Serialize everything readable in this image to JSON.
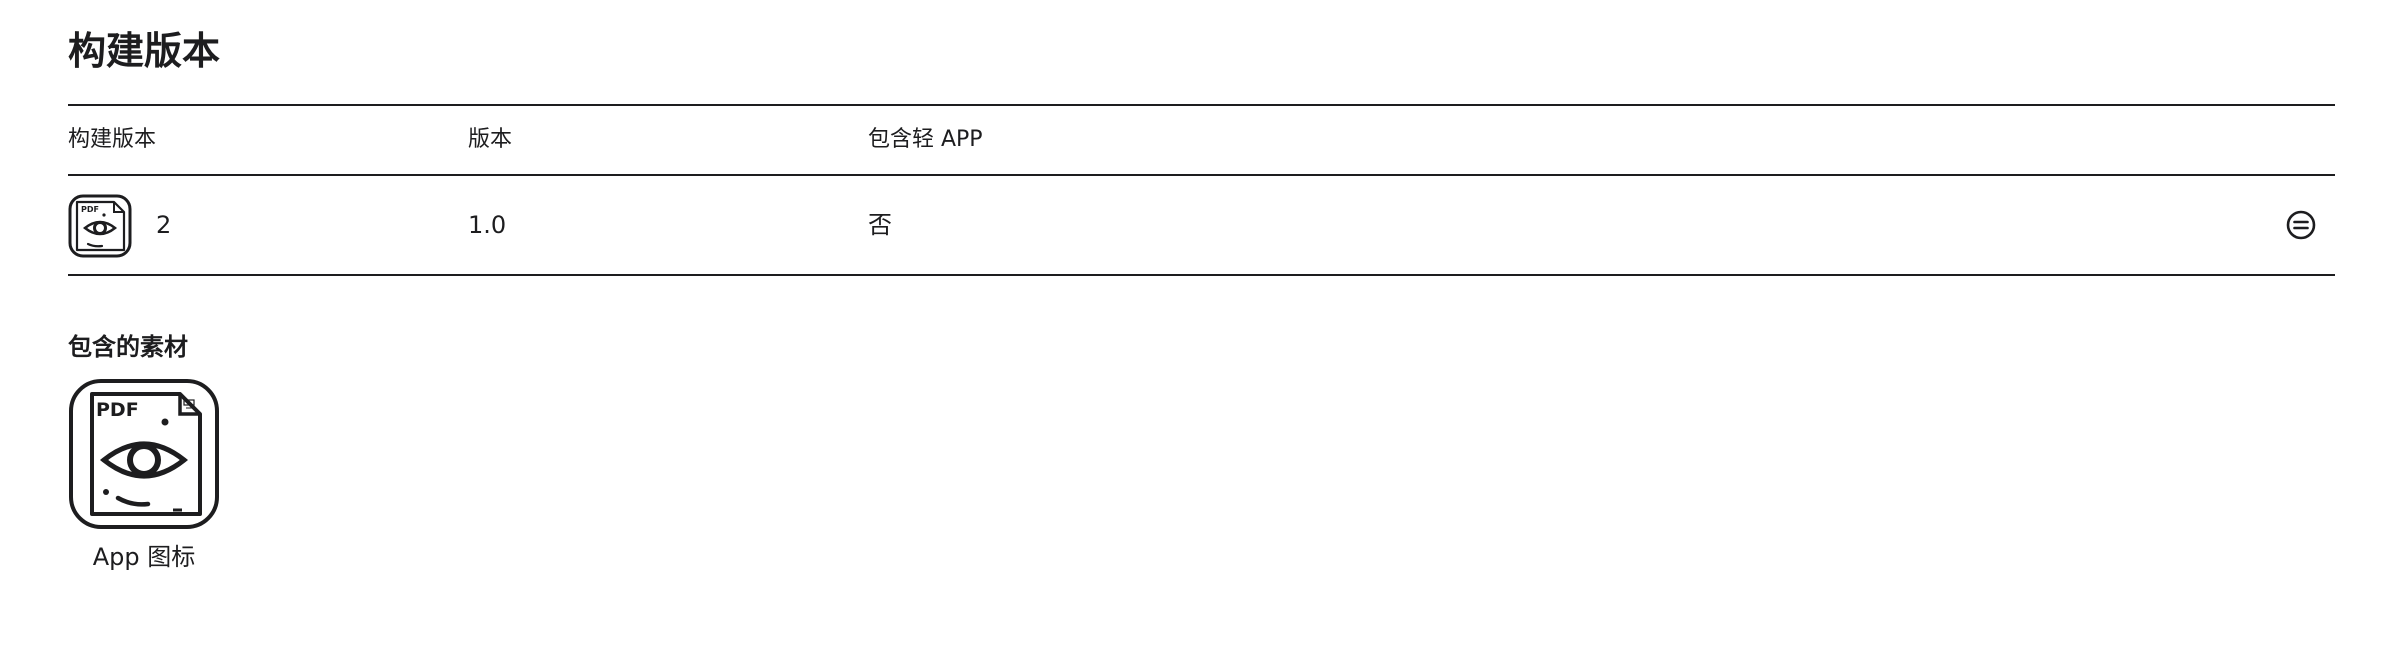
{
  "page": {
    "title": "构建版本"
  },
  "table": {
    "headers": {
      "build": "构建版本",
      "version": "版本",
      "includes_app_clip": "包含轻 APP"
    },
    "rows": [
      {
        "icon": "pdf-viewer-app-icon",
        "build": "2",
        "version": "1.0",
        "includes_app_clip": "否",
        "action_icon": "remove-circle-icon"
      }
    ]
  },
  "assets": {
    "title": "包含的素材",
    "items": [
      {
        "icon": "pdf-viewer-app-icon",
        "icon_text": "PDF",
        "label": "App 图标"
      }
    ]
  }
}
